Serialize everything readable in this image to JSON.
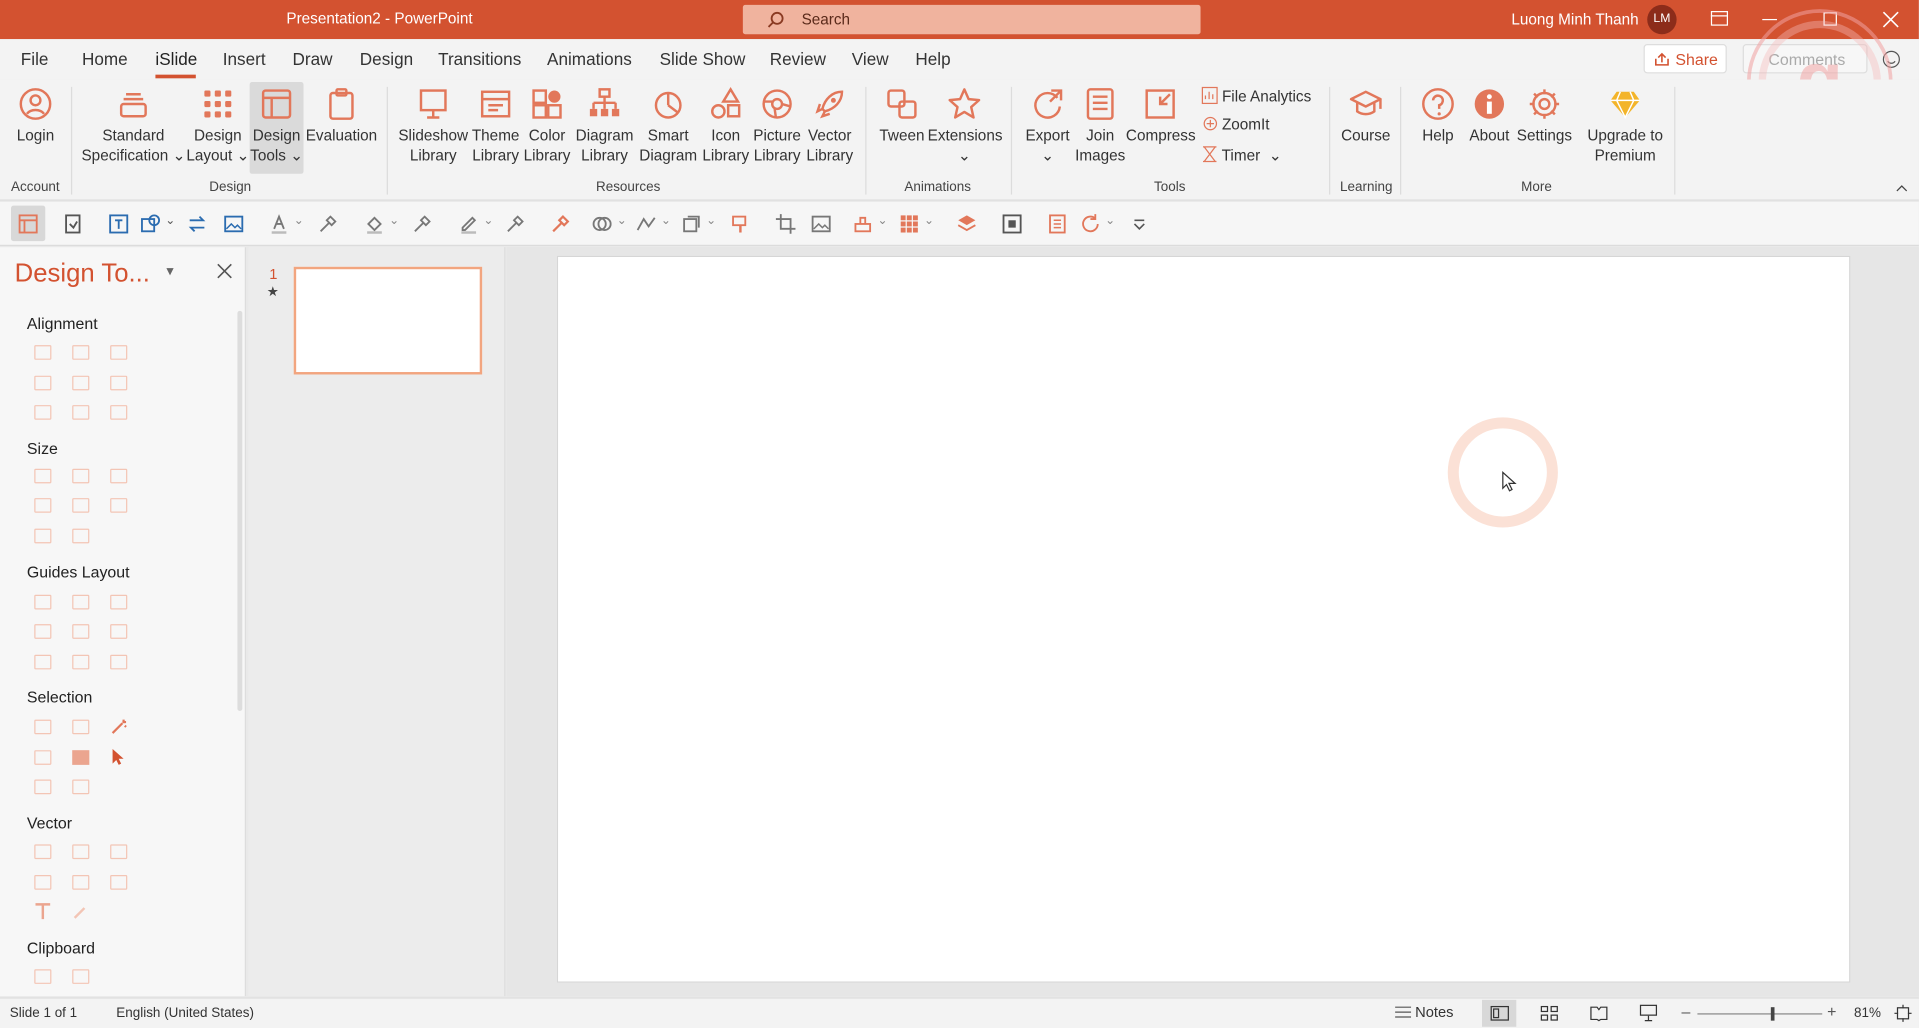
{
  "window": {
    "title": "Presentation2  -  PowerPoint",
    "search_placeholder": "Search",
    "user_name": "Luong Minh Thanh",
    "user_initials": "LM"
  },
  "tabs": [
    "File",
    "Home",
    "iSlide",
    "Insert",
    "Draw",
    "Design",
    "Transitions",
    "Animations",
    "Slide Show",
    "Review",
    "View",
    "Help"
  ],
  "active_tab": "iSlide",
  "share_label": "Share",
  "comments_label": "Comments",
  "ribbon": {
    "login": "Login",
    "standard_spec": [
      "Standard",
      "Specification"
    ],
    "design_layout": [
      "Design",
      "Layout"
    ],
    "design_tools": [
      "Design",
      "Tools"
    ],
    "evaluation": "Evaluation",
    "slideshow_library": [
      "Slideshow",
      "Library"
    ],
    "theme_library": [
      "Theme",
      "Library"
    ],
    "color_library": [
      "Color",
      "Library"
    ],
    "diagram_library": [
      "Diagram",
      "Library"
    ],
    "smart_diagram": [
      "Smart",
      "Diagram"
    ],
    "icon_library": [
      "Icon",
      "Library"
    ],
    "picture_library": [
      "Picture",
      "Library"
    ],
    "vector_library": [
      "Vector",
      "Library"
    ],
    "tween": "Tween",
    "extensions": "Extensions",
    "export": "Export",
    "join_images": [
      "Join",
      "Images"
    ],
    "compress": "Compress",
    "file_analytics": "File Analytics",
    "zoomit": "ZoomIt",
    "timer": "Timer",
    "course": "Course",
    "help": "Help",
    "about": "About",
    "settings": "Settings",
    "upgrade": [
      "Upgrade to",
      "Premium"
    ],
    "groups": {
      "account": "Account",
      "design": "Design",
      "resources": "Resources",
      "animations": "Animations",
      "tools": "Tools",
      "learning": "Learning",
      "more": "More"
    }
  },
  "pane": {
    "title": "Design To...",
    "sections": [
      "Alignment",
      "Size",
      "Guides Layout",
      "Selection",
      "Vector",
      "Clipboard"
    ]
  },
  "thumbs": {
    "slide_number": "1",
    "star": "★"
  },
  "status": {
    "slide": "Slide 1 of 1",
    "language": "English (United States)",
    "notes": "Notes",
    "zoom": "81%",
    "zoom_level": 0.6
  },
  "colors": {
    "accent": "#d35230",
    "icon": "#e2775a",
    "icon_light": "#f3c5b5",
    "premium": "#f3b429"
  }
}
